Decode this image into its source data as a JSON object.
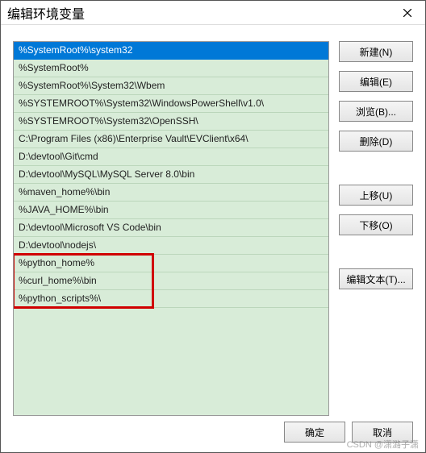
{
  "title": "编辑环境变量",
  "list": {
    "selectedIndex": 0,
    "items": [
      "%SystemRoot%\\system32",
      "%SystemRoot%",
      "%SystemRoot%\\System32\\Wbem",
      "%SYSTEMROOT%\\System32\\WindowsPowerShell\\v1.0\\",
      "%SYSTEMROOT%\\System32\\OpenSSH\\",
      "C:\\Program Files (x86)\\Enterprise Vault\\EVClient\\x64\\",
      "D:\\devtool\\Git\\cmd",
      "D:\\devtool\\MySQL\\MySQL Server 8.0\\bin",
      "%maven_home%\\bin",
      "%JAVA_HOME%\\bin",
      "D:\\devtool\\Microsoft VS Code\\bin",
      "D:\\devtool\\nodejs\\",
      "%python_home%",
      "%curl_home%\\bin",
      "%python_scripts%\\"
    ],
    "highlight": {
      "startIndex": 12,
      "endIndex": 14
    }
  },
  "buttons": {
    "new": "新建(N)",
    "edit": "编辑(E)",
    "browse": "浏览(B)...",
    "delete": "删除(D)",
    "moveUp": "上移(U)",
    "moveDown": "下移(O)",
    "editText": "编辑文本(T)...",
    "ok": "确定",
    "cancel": "取消"
  },
  "watermark": "CSDN @潇潞子潇"
}
